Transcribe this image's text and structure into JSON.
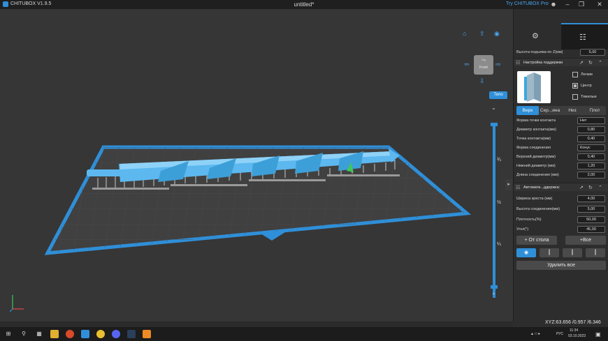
{
  "titlebar": {
    "app_name": "CHITUBOX V1.9.5",
    "document": "untitled*",
    "try_pro": "Try CHITUBOX Pro"
  },
  "viewport": {
    "nav_cube_front": "Front",
    "nav_cube_top": "Top",
    "body_button": "Тело",
    "z_labels": [
      "¾",
      "½",
      "¼"
    ],
    "xyz_readout": "XYZ:63.656 /0.957 /6.346"
  },
  "panel": {
    "lift_height_label": "Высота подъема по Z(мм)",
    "lift_height_value": "5,00",
    "support_settings_title": "Настройка поддержки",
    "presets": [
      {
        "label": "Легкие",
        "checked": false
      },
      {
        "label": "Центр",
        "checked": true
      },
      {
        "label": "Тяжелые",
        "checked": false
      }
    ],
    "tabs": [
      "Верх",
      "Сер...ина",
      "Низ",
      "Плот"
    ],
    "active_tab": "Верх",
    "fields": [
      {
        "label": "Форма точки контакта",
        "value": "Нет",
        "kind": "select"
      },
      {
        "label": "Диаметр контакта(мм)",
        "value": "0,80",
        "kind": "spin"
      },
      {
        "label": "Точка контакта(мм)",
        "value": "0,40",
        "kind": "spin"
      },
      {
        "label": "Форма соединения",
        "value": "Конус",
        "kind": "select"
      },
      {
        "label": "Верхний диаметр(мм)",
        "value": "0,40",
        "kind": "spin"
      },
      {
        "label": "Нижний диаметр (мм)",
        "value": "1,20",
        "kind": "spin"
      },
      {
        "label": "Длина соединения (мм)",
        "value": "2,00",
        "kind": "spin"
      }
    ],
    "auto_support_title": "Автомати...ддержка:",
    "auto_fields": [
      {
        "label": "Ширина креста (мм)",
        "value": "4,00"
      },
      {
        "label": "Высота соединения(мм)",
        "value": "5,00"
      },
      {
        "label": "Плотность(%)",
        "value": "50,00"
      },
      {
        "label": "Угол(°)",
        "value": "45,00"
      }
    ],
    "from_table_button": "+ От стола",
    "all_button": "+Все",
    "delete_all_button": "Удалить все"
  },
  "taskbar": {
    "language": "РУС",
    "time": "11:34",
    "date": "03.10.2023"
  },
  "colors": {
    "accent": "#2f8fd8",
    "model": "#5cb8ef",
    "plate_border": "#2f8fd8"
  }
}
